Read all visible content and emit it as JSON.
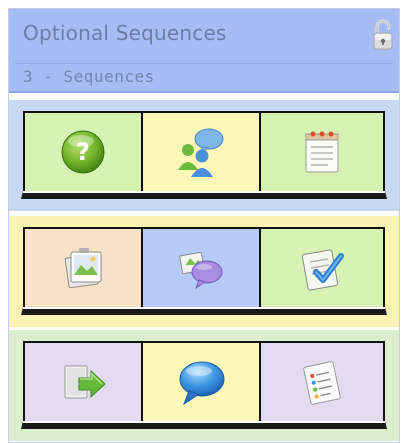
{
  "header": {
    "title": "Optional Sequences",
    "subtitle": "3 - Sequences",
    "lock_icon": "lock-open-icon"
  },
  "rows": [
    {
      "background": "#c7d8f3",
      "cells": [
        {
          "icon": "question-icon",
          "background": "#d6f3b3"
        },
        {
          "icon": "chat-users-icon",
          "background": "#fdf8b8"
        },
        {
          "icon": "notepad-icon",
          "background": "#d6f3b3"
        }
      ]
    },
    {
      "background": "#fbf3b3",
      "cells": [
        {
          "icon": "photo-stack-icon",
          "background": "#f7e2c7"
        },
        {
          "icon": "forum-chat-icon",
          "background": "#b8caf7"
        },
        {
          "icon": "checklist-icon",
          "background": "#d6f3b3"
        }
      ]
    },
    {
      "background": "#dbeecd",
      "cells": [
        {
          "icon": "submit-arrow-icon",
          "background": "#e3dcf0"
        },
        {
          "icon": "speech-bubble-icon",
          "background": "#fdf8b8"
        },
        {
          "icon": "list-document-icon",
          "background": "#e3dcf0"
        }
      ]
    }
  ]
}
